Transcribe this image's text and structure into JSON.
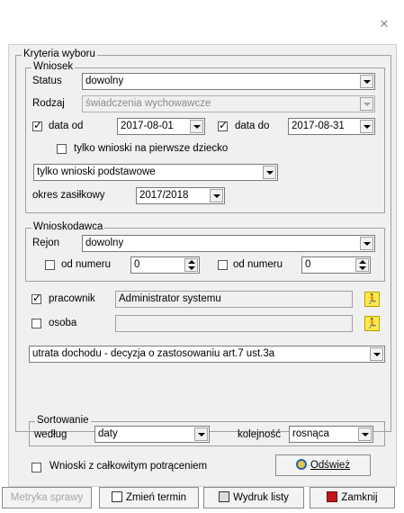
{
  "window": {
    "close_glyph": "✕"
  },
  "kryteria": {
    "legend": "Kryteria wyboru",
    "wniosek": {
      "legend": "Wniosek",
      "status_label": "Status",
      "status_value": "dowolny",
      "rodzaj_label": "Rodzaj",
      "rodzaj_value": "świadczenia wychowawcze",
      "data_od_label": "data od",
      "data_od_checked": true,
      "data_od_value": "2017-08-01",
      "data_do_label": "data do",
      "data_do_checked": true,
      "data_do_value": "2017-08-31",
      "pierwsze_label": "tylko wnioski na pierwsze dziecko",
      "pierwsze_checked": false,
      "typ_value": "tylko wnioski podstawowe",
      "okres_label": "okres zasiłkowy",
      "okres_value": "2017/2018"
    },
    "wnioskodawca": {
      "legend": "Wnioskodawca",
      "rejon_label": "Rejon",
      "rejon_value": "dowolny",
      "od_numeru_1_label": "od numeru",
      "od_numeru_1_value": "0",
      "od_numeru_2_label": "od numeru",
      "od_numeru_2_value": "0"
    },
    "pracownik_label": "pracownik",
    "pracownik_checked": true,
    "pracownik_value": "Administrator systemu",
    "osoba_label": "osoba",
    "osoba_checked": false,
    "osoba_value": "",
    "utrata_value": "utrata dochodu - decyzja o zastosowaniu art.7 ust.3a",
    "sortowanie": {
      "legend": "Sortowanie",
      "wedlug_label": "według",
      "wedlug_value": "daty",
      "kolejnosc_label": "kolejność",
      "kolejnosc_value": "rosnąca"
    },
    "potracenie_label": "Wnioski z całkowitym potrąceniem",
    "potracenie_checked": false,
    "odswiez_label": "Odśwież"
  },
  "buttons": {
    "metryka": "Metryka sprawy",
    "zmien_termin": "Zmień termin",
    "wydruk_listy": "Wydruk listy",
    "zamknij": "Zamknij"
  },
  "colors": {
    "accent_yellow": "#ffe94a",
    "zamknij_icon": "#c0161c"
  }
}
